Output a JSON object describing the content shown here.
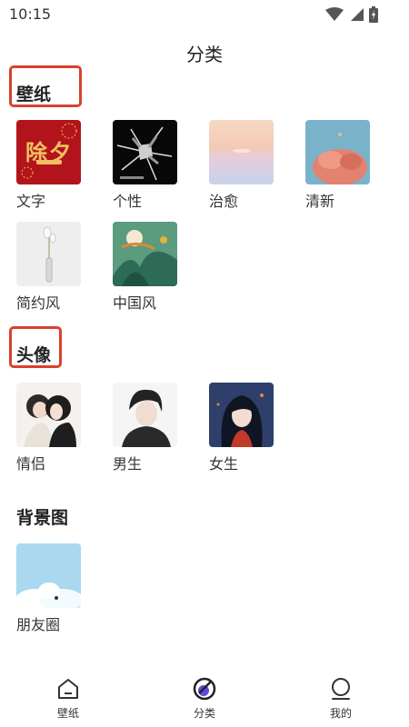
{
  "status": {
    "time": "10:15"
  },
  "header": {
    "title": "分类"
  },
  "sections": {
    "wallpaper": {
      "title": "壁纸",
      "items": [
        {
          "label": "文字",
          "thumb_text": "除夕"
        },
        {
          "label": "个性"
        },
        {
          "label": "治愈"
        },
        {
          "label": "清新"
        },
        {
          "label": "简约风"
        },
        {
          "label": "中国风"
        }
      ]
    },
    "avatar": {
      "title": "头像",
      "items": [
        {
          "label": "情侣"
        },
        {
          "label": "男生"
        },
        {
          "label": "女生"
        }
      ]
    },
    "background": {
      "title": "背景图",
      "items": [
        {
          "label": "朋友圈"
        }
      ]
    }
  },
  "nav": {
    "items": [
      {
        "label": "壁纸",
        "icon": "home-icon"
      },
      {
        "label": "分类",
        "icon": "category-icon",
        "active": true
      },
      {
        "label": "我的",
        "icon": "profile-icon"
      }
    ]
  },
  "colors": {
    "highlight": "#d9412b",
    "accent": "#5b4bdb"
  }
}
